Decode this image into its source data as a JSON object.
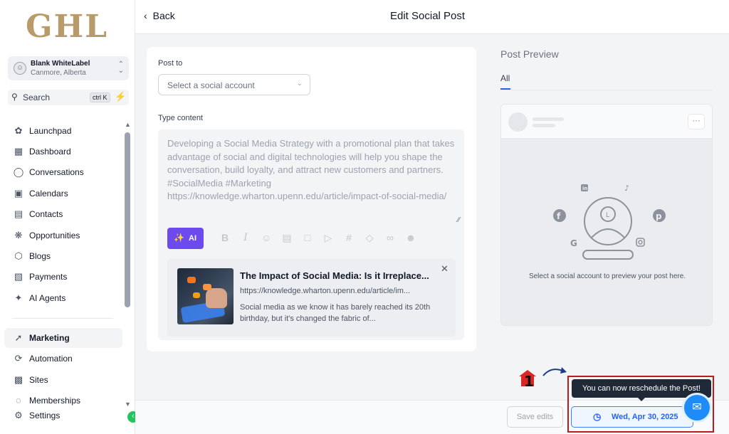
{
  "brand": {
    "logo_text": "GHL"
  },
  "account": {
    "name": "Blank WhiteLabel",
    "location": "Canmore, Alberta"
  },
  "search": {
    "label": "Search",
    "shortcut": "ctrl K"
  },
  "sidebar": {
    "items": [
      {
        "label": "Launchpad",
        "icon": "rocket-icon"
      },
      {
        "label": "Dashboard",
        "icon": "grid-icon"
      },
      {
        "label": "Conversations",
        "icon": "chat-icon"
      },
      {
        "label": "Calendars",
        "icon": "calendar-icon"
      },
      {
        "label": "Contacts",
        "icon": "contacts-icon"
      },
      {
        "label": "Opportunities",
        "icon": "opportunities-icon"
      },
      {
        "label": "Blogs",
        "icon": "cube-icon"
      },
      {
        "label": "Payments",
        "icon": "receipt-icon"
      },
      {
        "label": "AI Agents",
        "icon": "sparkle-icon"
      },
      {
        "label": "Marketing",
        "icon": "megaphone-icon",
        "active": true
      },
      {
        "label": "Automation",
        "icon": "automation-icon"
      },
      {
        "label": "Sites",
        "icon": "sites-icon"
      },
      {
        "label": "Memberships",
        "icon": "memberships-icon"
      },
      {
        "label": "Settings",
        "icon": "gear-icon"
      }
    ]
  },
  "header": {
    "back_label": "Back",
    "title": "Edit Social Post"
  },
  "editor": {
    "post_to_label": "Post to",
    "account_placeholder": "Select a social account",
    "content_label": "Type content",
    "content_text": "Developing a Social Media Strategy with a promotional plan that takes advantage of social and digital technologies will help you shape the conversation, build loyalty, and attract new customers and partners.\n#SocialMedia #Marketing\nhttps://knowledge.wharton.upenn.edu/article/impact-of-social-media/",
    "ai_label": "AI",
    "link_preview": {
      "title": "The Impact of Social Media: Is it Irreplace...",
      "url": "https://knowledge.wharton.upenn.edu/article/im...",
      "description": "Social media as we know it has barely reached its 20th birthday, but it's changed the fabric of..."
    }
  },
  "preview": {
    "title": "Post Preview",
    "tab_all": "All",
    "empty_message": "Select a social account to preview your post here."
  },
  "footer": {
    "save_label": "Save edits",
    "date_label": "Wed, Apr 30, 2025"
  },
  "annotation": {
    "tooltip": "You can now reschedule the Post!",
    "step_number": "1"
  },
  "colors": {
    "accent": "#2563eb",
    "ai_button": "#6d4aed",
    "highlight_border": "#b91c1c",
    "logo": "#b89b6a"
  }
}
